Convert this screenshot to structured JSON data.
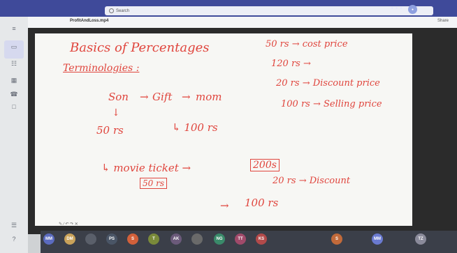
{
  "window": {
    "search_placeholder": "Search",
    "filename": "ProfitAndLoss.mp4",
    "right_label": "Share"
  },
  "leftrail": {
    "items": [
      {
        "icon": "activity-icon",
        "glyph": "≡",
        "label": "Activity"
      },
      {
        "icon": "chat-icon",
        "glyph": "▭",
        "label": "Chat"
      },
      {
        "icon": "teams-icon",
        "glyph": "☷",
        "label": "Teams"
      },
      {
        "icon": "calendar-icon",
        "glyph": "▦",
        "label": "Calendar"
      },
      {
        "icon": "calls-icon",
        "glyph": "☎",
        "label": "Calls"
      },
      {
        "icon": "files-icon",
        "glyph": "□",
        "label": "Files"
      },
      {
        "icon": "apps-icon",
        "glyph": "☰",
        "label": "Apps"
      },
      {
        "icon": "help-icon",
        "glyph": "?",
        "label": "Help"
      }
    ]
  },
  "whiteboard": {
    "title": "Basics of Percentages",
    "subtitle": "Terminologies :",
    "flow": {
      "son": "Son",
      "arrow1": "→",
      "gift": "Gift",
      "arrow2": "→",
      "mom": "mom"
    },
    "down_arrow": "↓",
    "amount_left": "50 rs",
    "amount_gift": "↳ 100 rs",
    "movie_branch": "↳ movie ticket →",
    "ticket_price": "200s",
    "movie_paid": "50 rs",
    "arrow_100": "→",
    "amount_100": "100 rs",
    "discount_line": "20 rs → Discount",
    "legend": [
      "50 rs → cost price",
      "120 rs →",
      "20 rs → Discount price",
      "100 rs → Selling price"
    ],
    "pen_toolbar": "✎ ∕ ↶ ↷ ✕"
  },
  "dock": {
    "participants": [
      {
        "initials": "MM",
        "color": "#5b6bbf"
      },
      {
        "initials": "DM",
        "color": "#c9a25a"
      },
      {
        "initials": "",
        "color": "#5a5f6a"
      },
      {
        "initials": "PS",
        "color": "#4a5566"
      },
      {
        "initials": "S",
        "color": "#d2603a"
      },
      {
        "initials": "T",
        "color": "#7a8a3a"
      },
      {
        "initials": "AK",
        "color": "#6b5a7a"
      },
      {
        "initials": "",
        "color": "#6a6a6a"
      },
      {
        "initials": "NG",
        "color": "#3a8a6a"
      },
      {
        "initials": "TT",
        "color": "#a04a6a"
      },
      {
        "initials": "KS",
        "color": "#b24a4a"
      },
      {
        "initials": "S",
        "color": "#c26a3a"
      },
      {
        "initials": "MM",
        "color": "#6a7ad0"
      },
      {
        "initials": "TZ",
        "color": "#8a8a9a"
      }
    ]
  }
}
